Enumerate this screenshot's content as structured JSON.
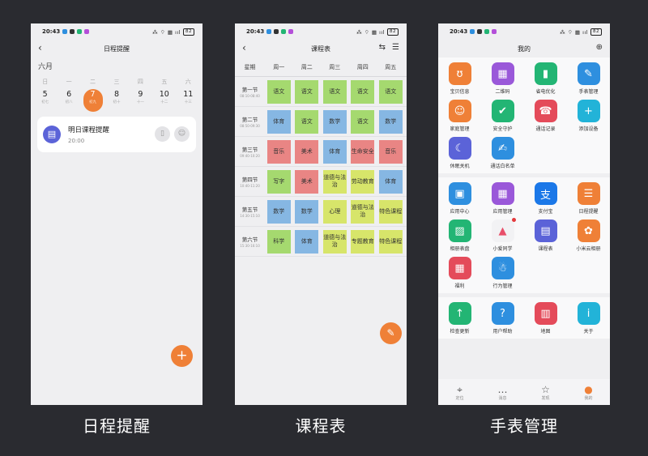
{
  "status": {
    "time": "20:43",
    "signal": "⁂ ⌔ ▦ ııl",
    "battery": "82"
  },
  "captions": [
    "日程提醒",
    "课程表",
    "手表管理"
  ],
  "reminder": {
    "title": "日程提醒",
    "month": "六月",
    "weekdays": [
      "日",
      "一",
      "二",
      "三",
      "四",
      "五",
      "六"
    ],
    "dates": [
      {
        "num": "5",
        "lunar": "初七"
      },
      {
        "num": "6",
        "lunar": "初八"
      },
      {
        "num": "7",
        "lunar": "初九"
      },
      {
        "num": "8",
        "lunar": "初十"
      },
      {
        "num": "9",
        "lunar": "十一"
      },
      {
        "num": "10",
        "lunar": "十二"
      },
      {
        "num": "11",
        "lunar": "十三"
      }
    ],
    "card_title": "明日课程提醒",
    "card_time": "20:00",
    "fab": "+"
  },
  "schedule": {
    "title": "课程表",
    "headers": [
      "星期",
      "周一",
      "周二",
      "周三",
      "周四",
      "周五"
    ],
    "rows": [
      {
        "name": "第一节",
        "time": "08:10-08:40",
        "cells": [
          "语文",
          "语文",
          "语文",
          "语文",
          "语文"
        ]
      },
      {
        "name": "第二节",
        "time": "08:50-09:30",
        "cells": [
          "体育",
          "语文",
          "数学",
          "语文",
          "数学"
        ]
      },
      {
        "name": "第三节",
        "time": "09:40-10:20",
        "cells": [
          "音乐",
          "美术",
          "体育",
          "生命安全",
          "音乐"
        ]
      },
      {
        "name": "第四节",
        "time": "10:40-11:20",
        "cells": [
          "写字",
          "美术",
          "道德与法治",
          "劳动教育",
          "体育"
        ]
      },
      {
        "name": "第五节",
        "time": "14:30-15:10",
        "cells": [
          "数学",
          "数学",
          "心理",
          "道德与法治",
          "特色课程"
        ]
      },
      {
        "name": "第六节",
        "time": "15:30-16:10",
        "cells": [
          "科学",
          "体育",
          "道德与法治",
          "专题教育",
          "特色课程"
        ]
      }
    ],
    "colors": {
      "语文": "#a5d96f",
      "体育": "#86b7e3",
      "数学": "#86b7e3",
      "音乐": "#e98584",
      "美术": "#e98584",
      "生命安全": "#e98584",
      "写字": "#a5d96f",
      "道德与法治": "#d7e56a",
      "劳动教育": "#d7e56a",
      "心理": "#d7e56a",
      "特色课程": "#d7e56a",
      "科学": "#a5d96f",
      "专题教育": "#d7e56a"
    },
    "fab": "✎"
  },
  "watch": {
    "title": "我的",
    "sections": [
      [
        {
          "label": "宝贝信息",
          "icon": "ʊ",
          "color": "#ef8037"
        },
        {
          "label": "二维码",
          "icon": "▦",
          "color": "#9a58d9"
        },
        {
          "label": "省电优化",
          "icon": "▮",
          "color": "#23b574"
        },
        {
          "label": "手表管理",
          "icon": "✎",
          "color": "#2e8fdf"
        },
        {
          "label": "家庭管理",
          "icon": "☺",
          "color": "#ef8037"
        },
        {
          "label": "安全守护",
          "icon": "✔",
          "color": "#23b574"
        },
        {
          "label": "通话记录",
          "icon": "☎",
          "color": "#e44b5a"
        },
        {
          "label": "添加设备",
          "icon": "+",
          "color": "#22b3d8"
        },
        {
          "label": "休眠关机",
          "icon": "☾",
          "color": "#5b63d8"
        },
        {
          "label": "通话白名单",
          "icon": "✍",
          "color": "#2e8fdf"
        }
      ],
      [
        {
          "label": "应用中心",
          "icon": "▣",
          "color": "#2e8fdf"
        },
        {
          "label": "应用管理",
          "icon": "▦",
          "color": "#9a58d9"
        },
        {
          "label": "支付宝",
          "icon": "支",
          "color": "#1b78e8"
        },
        {
          "label": "日程提醒",
          "icon": "☰",
          "color": "#ef8037"
        },
        {
          "label": "相册表盘",
          "icon": "▨",
          "color": "#23b574"
        },
        {
          "label": "小爱同学",
          "icon": "▲",
          "color": "#f2f2f4",
          "dot": true
        },
        {
          "label": "课程表",
          "icon": "▤",
          "color": "#5b63d8"
        },
        {
          "label": "小米云相册",
          "icon": "✿",
          "color": "#ef8037"
        },
        {
          "label": "福利",
          "icon": "▦",
          "color": "#e44b5a"
        },
        {
          "label": "行为管理",
          "icon": "☃",
          "color": "#2e8fdf"
        }
      ],
      [
        {
          "label": "检查更新",
          "icon": "↑",
          "color": "#23b574"
        },
        {
          "label": "用户帮助",
          "icon": "?",
          "color": "#2e8fdf"
        },
        {
          "label": "地图",
          "icon": "▥",
          "color": "#e44b5a"
        },
        {
          "label": "关于",
          "icon": "i",
          "color": "#22b3d8"
        }
      ]
    ],
    "nav": [
      {
        "label": "定位",
        "icon": "⌖"
      },
      {
        "label": "消息",
        "icon": "…"
      },
      {
        "label": "发现",
        "icon": "☆"
      },
      {
        "label": "我的",
        "icon": "●"
      }
    ]
  }
}
